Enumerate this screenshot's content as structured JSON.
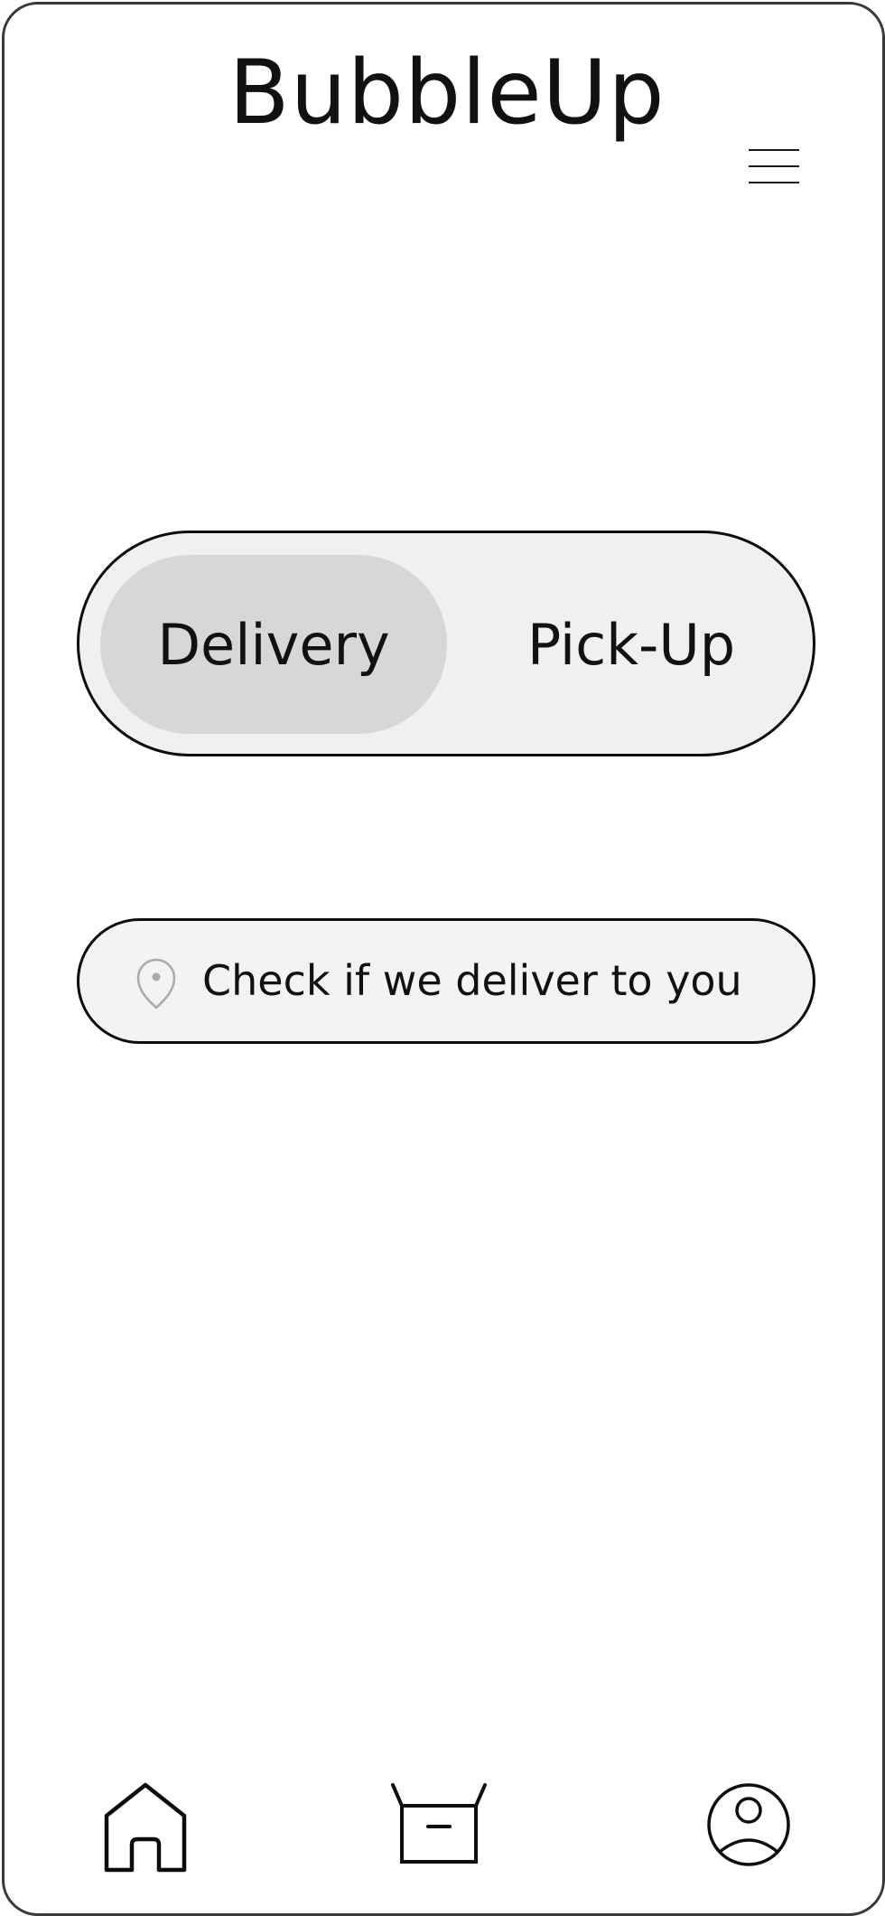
{
  "app": {
    "title": "BubbleUp"
  },
  "header": {
    "menu_icon": "hamburger-menu-icon"
  },
  "order_mode": {
    "options": [
      {
        "label": "Delivery",
        "selected": true
      },
      {
        "label": "Pick-Up",
        "selected": false
      }
    ]
  },
  "address_check": {
    "placeholder": "Check if we deliver to you",
    "value": "",
    "icon": "location-pin-icon"
  },
  "bottom_nav": {
    "items": [
      {
        "icon": "home-icon"
      },
      {
        "icon": "box-icon"
      },
      {
        "icon": "profile-icon"
      }
    ]
  },
  "colors": {
    "frame_border": "#3a3a3a",
    "toggle_background": "#f0f0f0",
    "toggle_active": "#d7d7d7",
    "search_background": "#f3f3f3",
    "pin_icon": "#aaaaaa",
    "stroke": "#0d0d0d"
  }
}
